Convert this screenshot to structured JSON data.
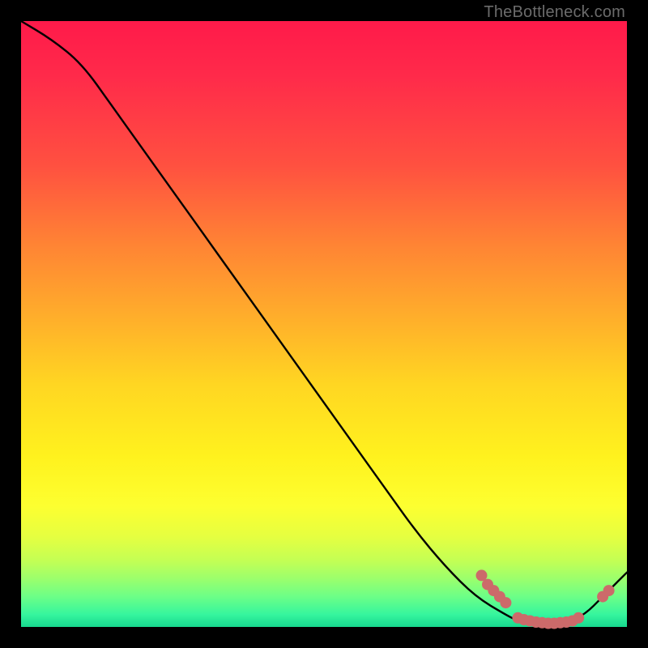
{
  "watermark": "TheBottleneck.com",
  "chart_data": {
    "type": "line",
    "title": "",
    "xlabel": "",
    "ylabel": "",
    "xlim": [
      0,
      100
    ],
    "ylim": [
      0,
      100
    ],
    "grid": false,
    "legend": false,
    "series": [
      {
        "name": "curve",
        "color": "#000000",
        "x": [
          0,
          5,
          10,
          15,
          20,
          25,
          30,
          35,
          40,
          45,
          50,
          55,
          60,
          65,
          70,
          75,
          80,
          82,
          85,
          88,
          90,
          93,
          96,
          100
        ],
        "y": [
          100,
          97,
          93,
          86,
          79,
          72,
          65,
          58,
          51,
          44,
          37,
          30,
          23,
          16,
          10,
          5,
          2,
          1,
          0.5,
          0.5,
          0.7,
          2,
          5,
          9
        ]
      }
    ],
    "markers": [
      {
        "name": "dots",
        "color": "#cc6a6a",
        "radius_px": 7,
        "points": [
          {
            "x": 76,
            "y": 8.5
          },
          {
            "x": 77,
            "y": 7
          },
          {
            "x": 78,
            "y": 6
          },
          {
            "x": 79,
            "y": 5
          },
          {
            "x": 80,
            "y": 4
          },
          {
            "x": 82,
            "y": 1.5
          },
          {
            "x": 83,
            "y": 1.2
          },
          {
            "x": 84,
            "y": 1.0
          },
          {
            "x": 85,
            "y": 0.8
          },
          {
            "x": 86,
            "y": 0.7
          },
          {
            "x": 87,
            "y": 0.6
          },
          {
            "x": 88,
            "y": 0.6
          },
          {
            "x": 89,
            "y": 0.7
          },
          {
            "x": 90,
            "y": 0.8
          },
          {
            "x": 91,
            "y": 1.0
          },
          {
            "x": 92,
            "y": 1.5
          },
          {
            "x": 96,
            "y": 5
          },
          {
            "x": 97,
            "y": 6
          }
        ]
      }
    ]
  }
}
